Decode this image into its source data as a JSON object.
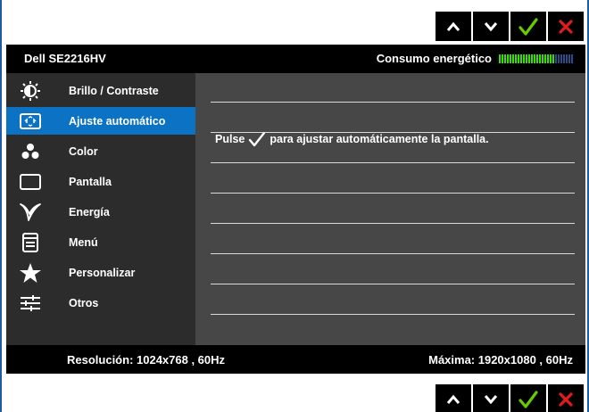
{
  "monitor": {
    "model": "Dell SE2216HV",
    "energy_label": "Consumo energético",
    "energy_meter": {
      "level": 0.75,
      "segments": 28
    }
  },
  "buttons": [
    "up-icon",
    "down-icon",
    "check-icon",
    "close-icon"
  ],
  "menu": {
    "selected_index": 1,
    "items": [
      {
        "label": "Brillo / Contraste",
        "icon": "brightness-icon"
      },
      {
        "label": "Ajuste automático",
        "icon": "auto-adjust-icon"
      },
      {
        "label": "Color",
        "icon": "color-icon"
      },
      {
        "label": "Pantalla",
        "icon": "display-icon"
      },
      {
        "label": "Energía",
        "icon": "energy-icon"
      },
      {
        "label": "Menú",
        "icon": "menu-icon"
      },
      {
        "label": "Personalizar",
        "icon": "star-icon"
      },
      {
        "label": "Otros",
        "icon": "sliders-icon"
      }
    ]
  },
  "content": {
    "hint_before": "Pulse",
    "hint_after": "para ajustar automáticamente la pantalla."
  },
  "footer": {
    "resolution": "Resolución: 1024x768 , 60Hz",
    "max_resolution": "Máxima: 1920x1080 , 60Hz"
  },
  "colors": {
    "selected_bg": "#0b72c4",
    "check": "#66cc00",
    "close": "#e31b1b",
    "energy_on": "#33e000",
    "energy_off": "#2e4b87"
  }
}
